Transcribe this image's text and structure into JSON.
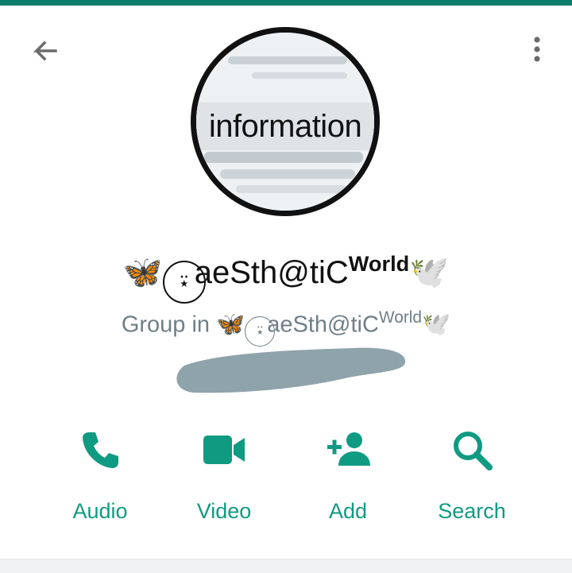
{
  "header": {
    "back_icon": "arrow-left-icon",
    "menu_icon": "more-vert-icon"
  },
  "avatar": {
    "image_text": "information",
    "alt": "group profile picture with magnifying glass"
  },
  "group": {
    "name_prefix": "🦋",
    "name_badge": "⍣",
    "name_main": "aeSth@tiC",
    "name_sup": "World",
    "name_suffix": "🕊️",
    "subtitle_prefix": "Group in ",
    "subtitle_sup": "World"
  },
  "actions": [
    {
      "label": "Audio",
      "icon": "phone-icon"
    },
    {
      "label": "Video",
      "icon": "videocam-icon"
    },
    {
      "label": "Add",
      "icon": "add-person-icon"
    },
    {
      "label": "Search",
      "icon": "search-icon"
    }
  ],
  "colors": {
    "accent": "#0f9b82",
    "topbar": "#0b7e6c",
    "subtitle": "#6f7f87",
    "redaction": "#8fa3ab"
  }
}
